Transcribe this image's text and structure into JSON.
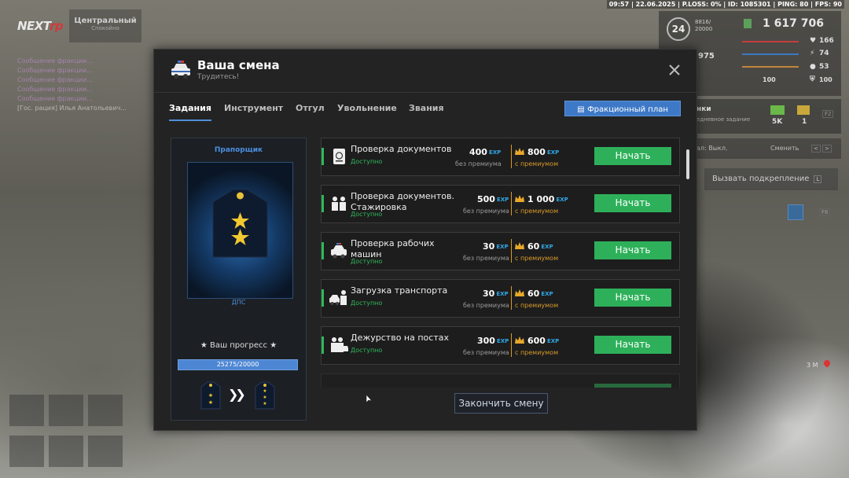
{
  "hud": {
    "status_bar": "09:57 | 22.06.2025 | P.LOSS: 0% | ID: 1085301 | PING: 80 | FPS: 90",
    "logo": {
      "part1": "NEXT",
      "part2": "rp"
    },
    "zone": {
      "title": "Центральный",
      "subtitle": "Спокойно"
    },
    "chat": [
      {
        "text": "Сообщение фракции...",
        "color": "#b88ac0"
      },
      {
        "text": "Сообщение фракции...",
        "color": "#b88ac0"
      },
      {
        "text": "Сообщение фракции...",
        "color": "#b88ac0"
      },
      {
        "text": "Сообщение фракции...",
        "color": "#b88ac0"
      },
      {
        "text": "Сообщение фракции...",
        "color": "#b88ac0"
      },
      {
        "text": "[Гос. рация] Илья Анатольевич...",
        "color": "#cfcfcf"
      }
    ],
    "level": "24",
    "level_exp": {
      "line1": "8816/",
      "line2": "20000"
    },
    "money": "1 617 706",
    "points": "975",
    "stats": {
      "health": "166",
      "stamina": "74",
      "hunger": "53",
      "armor_left": "100",
      "armor_right": "100"
    },
    "tasks_panel": {
      "title": "нки",
      "subtitle": "едневное задание",
      "reward1": "5K",
      "reward2": "1",
      "key": "F2"
    },
    "radio": {
      "label": "ал: Выкл.",
      "switch": "Сменить",
      "key1": "<",
      "key2": ">"
    },
    "backup_button": {
      "label": "Вызвать подкрепление",
      "key": "L"
    },
    "f6_key": "F6",
    "distance": "3 М"
  },
  "modal": {
    "title": "Ваша смена",
    "subtitle": "Трудитесь!",
    "tabs": [
      {
        "label": "Задания",
        "active": true
      },
      {
        "label": "Инструмент",
        "active": false
      },
      {
        "label": "Отгул",
        "active": false
      },
      {
        "label": "Увольнение",
        "active": false
      },
      {
        "label": "Звания",
        "active": false
      }
    ],
    "plan_button": "Фракционный план",
    "rank": {
      "name": "Прапорщик",
      "division": "ДПС",
      "progress_title": "★ Ваш прогресс ★",
      "progress_text": "25275/20000",
      "progress_fraction": 1.0
    },
    "exp_tag": "EXP",
    "label_no_premium": "без премиума",
    "label_premium": "с премиумом",
    "status_available": "Доступно",
    "start_label": "Начать",
    "tasks": [
      {
        "name": "Проверка документов",
        "exp": "400",
        "exp_premium": "800",
        "icon": "passport-icon"
      },
      {
        "name": "Проверка документов. Стажировка",
        "exp": "500",
        "exp_premium": "1 000",
        "icon": "officers-icon"
      },
      {
        "name": "Проверка рабочих машин",
        "exp": "30",
        "exp_premium": "60",
        "icon": "police-car-icon"
      },
      {
        "name": "Загрузка транспорта",
        "exp": "30",
        "exp_premium": "60",
        "icon": "tow-officer-icon"
      },
      {
        "name": "Дежурство на постах",
        "exp": "300",
        "exp_premium": "600",
        "icon": "patrol-post-icon"
      }
    ],
    "finish_button": "Закончить смену"
  }
}
